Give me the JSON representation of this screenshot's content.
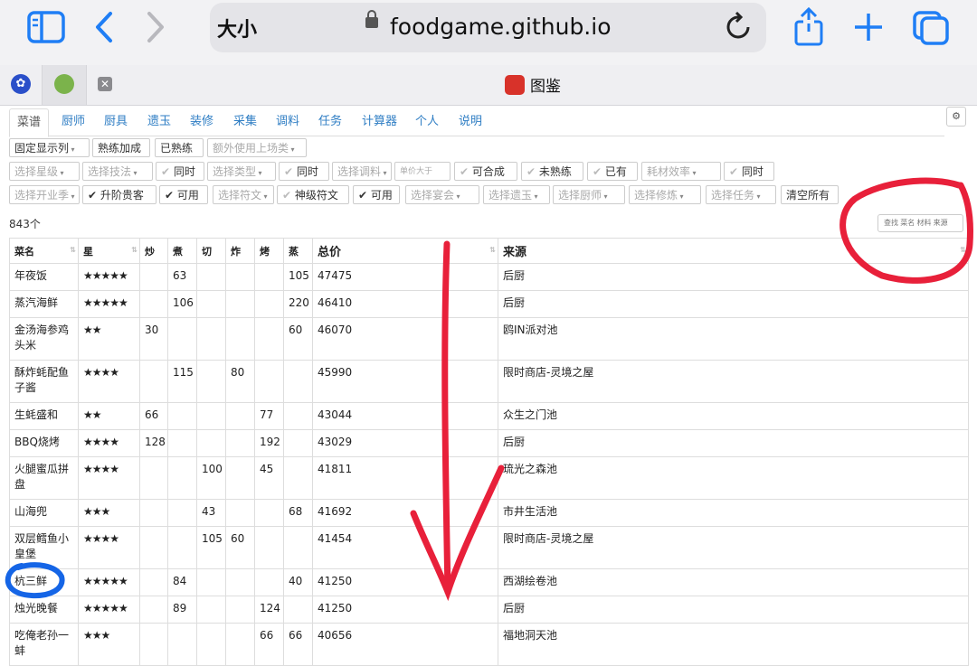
{
  "browser": {
    "text_size_label": "大小",
    "url": "foodgame.github.io",
    "tab_title": "图鉴",
    "icons": [
      "sidebar-icon",
      "back-icon",
      "forward-icon",
      "lock-icon",
      "reload-icon",
      "share-icon",
      "new-tab-icon",
      "tabs-overview-icon"
    ]
  },
  "nav": {
    "tabs": [
      "菜谱",
      "厨师",
      "厨具",
      "遗玉",
      "装修",
      "采集",
      "调料",
      "任务",
      "计算器",
      "个人",
      "说明"
    ],
    "active": "菜谱"
  },
  "filters": {
    "row1": [
      "固定显示列",
      "熟练加成",
      "已熟练",
      "额外使用上场类"
    ],
    "row2": [
      "选择星级",
      "选择技法",
      "同时",
      "选择类型",
      "同时",
      "选择调料",
      "单价大于",
      "可合成",
      "未熟练",
      "已有",
      "耗材效率",
      "同时"
    ],
    "row3": [
      "选择开业季",
      "升阶贵客",
      "可用",
      "选择符文",
      "神级符文",
      "可用",
      "选择宴会",
      "选择遗玉",
      "选择厨师",
      "选择修炼",
      "选择任务",
      "清空所有"
    ],
    "search_placeholder": "查找 菜名 材料 来源"
  },
  "count_text": "843个",
  "table": {
    "columns": [
      "菜名",
      "星",
      "炒",
      "煮",
      "切",
      "炸",
      "烤",
      "蒸",
      "总价",
      "来源"
    ],
    "rows": [
      {
        "name": "年夜饭",
        "stars": "★★★★★",
        "chao": "",
        "zhu": "63",
        "qie": "",
        "zha": "",
        "kao": "",
        "zheng": "105",
        "total": "47475",
        "source": "后厨"
      },
      {
        "name": "蒸汽海鲜",
        "stars": "★★★★★",
        "chao": "",
        "zhu": "106",
        "qie": "",
        "zha": "",
        "kao": "",
        "zheng": "220",
        "total": "46410",
        "source": "后厨"
      },
      {
        "name": "金汤海参鸡头米",
        "stars": "★★",
        "chao": "30",
        "zhu": "",
        "qie": "",
        "zha": "",
        "kao": "",
        "zheng": "60",
        "total": "46070",
        "source": "鸥IN派对池"
      },
      {
        "name": "酥炸蚝配鱼子酱",
        "stars": "★★★★",
        "chao": "",
        "zhu": "115",
        "qie": "",
        "zha": "80",
        "kao": "",
        "zheng": "",
        "total": "45990",
        "source": "限时商店-灵境之屋"
      },
      {
        "name": "生蚝盛和",
        "stars": "★★",
        "chao": "66",
        "zhu": "",
        "qie": "",
        "zha": "",
        "kao": "77",
        "zheng": "",
        "total": "43044",
        "source": "众生之门池"
      },
      {
        "name": "BBQ烧烤",
        "stars": "★★★★",
        "chao": "128",
        "zhu": "",
        "qie": "",
        "zha": "",
        "kao": "192",
        "zheng": "",
        "total": "43029",
        "source": "后厨"
      },
      {
        "name": "火腿蜜瓜拼盘",
        "stars": "★★★★",
        "chao": "",
        "zhu": "",
        "qie": "100",
        "zha": "",
        "kao": "45",
        "zheng": "",
        "total": "41811",
        "source": "琉光之森池"
      },
      {
        "name": "山海兜",
        "stars": "★★★",
        "chao": "",
        "zhu": "",
        "qie": "43",
        "zha": "",
        "kao": "",
        "zheng": "68",
        "total": "41692",
        "source": "市井生活池"
      },
      {
        "name": "双层鳕鱼小皇堡",
        "stars": "★★★★",
        "chao": "",
        "zhu": "",
        "qie": "105",
        "zha": "60",
        "kao": "",
        "zheng": "",
        "total": "41454",
        "source": "限时商店-灵境之屋"
      },
      {
        "name": "杭三鲜",
        "stars": "★★★★★",
        "chao": "",
        "zhu": "84",
        "qie": "",
        "zha": "",
        "kao": "",
        "zheng": "40",
        "total": "41250",
        "source": "西湖绘卷池"
      },
      {
        "name": "烛光晚餐",
        "stars": "★★★★★",
        "chao": "",
        "zhu": "89",
        "qie": "",
        "zha": "",
        "kao": "124",
        "zheng": "",
        "total": "41250",
        "source": "后厨"
      },
      {
        "name": "吃俺老孙一蚌",
        "stars": "★★★",
        "chao": "",
        "zhu": "",
        "qie": "",
        "zha": "",
        "kao": "66",
        "zheng": "66",
        "total": "40656",
        "source": "福地洞天池"
      }
    ]
  },
  "colors": {
    "ios_blue": "#1f7ef5",
    "link_blue": "#2f7ec4",
    "annotation_red": "#e8203a",
    "annotation_blue": "#1565e6"
  }
}
